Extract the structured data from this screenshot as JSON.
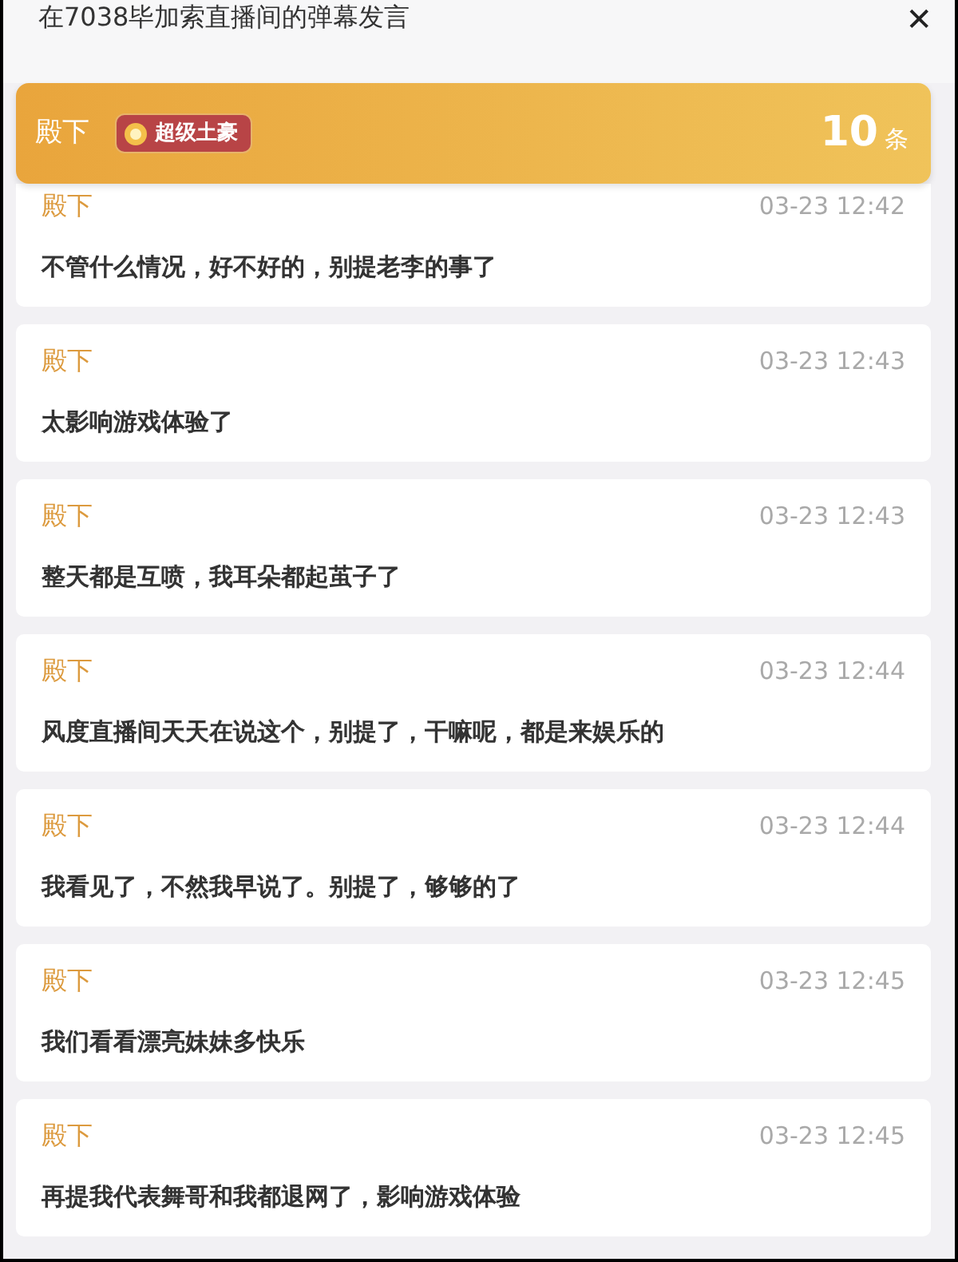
{
  "window": {
    "title": "在7038毕加索直播间的弹幕发言",
    "close": "✕"
  },
  "user_bar": {
    "name": "殿下",
    "badge": "超级土豪",
    "count": "10",
    "count_unit": "条"
  },
  "messages": [
    {
      "name": "殿下",
      "time": "03-23 12:42",
      "text": "不管什么情况，好不好的，别提老李的事了"
    },
    {
      "name": "殿下",
      "time": "03-23 12:43",
      "text": "太影响游戏体验了"
    },
    {
      "name": "殿下",
      "time": "03-23 12:43",
      "text": "整天都是互喷，我耳朵都起茧子了"
    },
    {
      "name": "殿下",
      "time": "03-23 12:44",
      "text": "风度直播间天天在说这个，别提了，干嘛呢，都是来娱乐的"
    },
    {
      "name": "殿下",
      "time": "03-23 12:44",
      "text": "我看见了，不然我早说了。别提了，够够的了"
    },
    {
      "name": "殿下",
      "time": "03-23 12:45",
      "text": "我们看看漂亮妹妹多快乐"
    },
    {
      "name": "殿下",
      "time": "03-23 12:45",
      "text": "再提我代表舞哥和我都退网了，影响游戏体验"
    }
  ]
}
